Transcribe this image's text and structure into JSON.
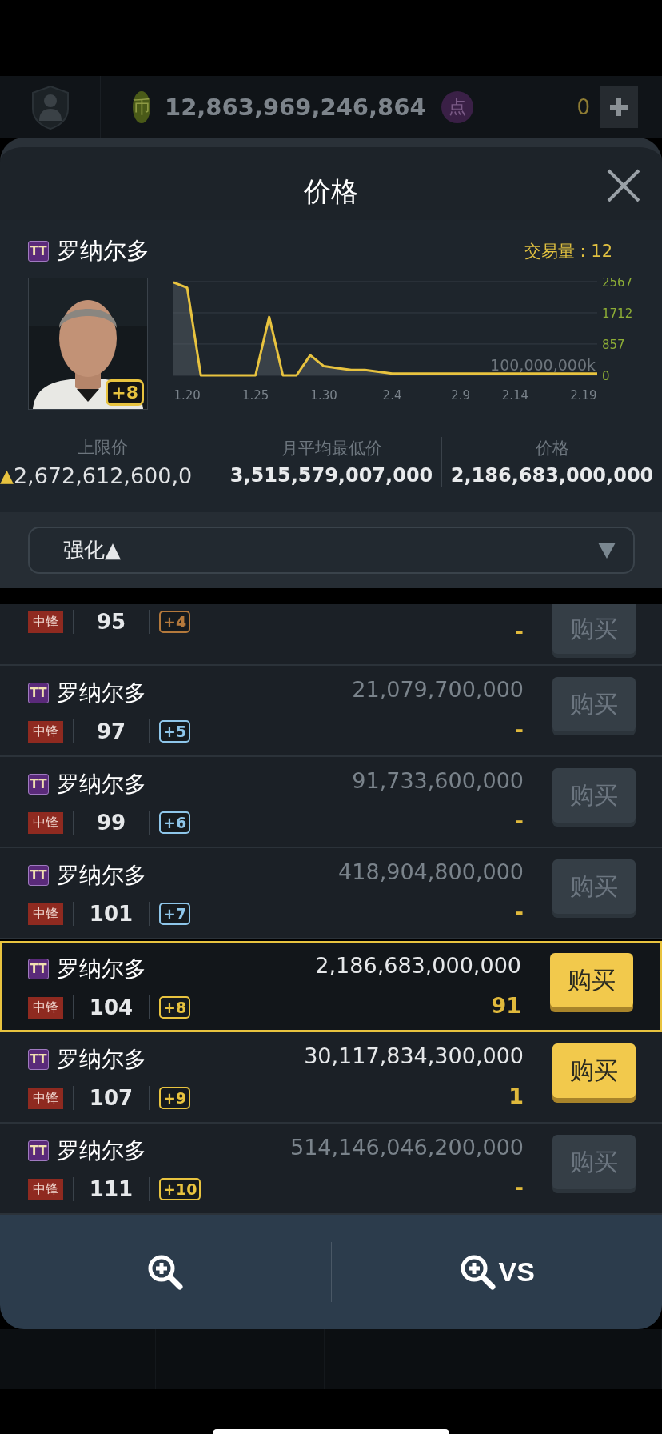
{
  "top_bar": {
    "coins": {
      "icon_text": "币",
      "amount": "12,863,969,246,864"
    },
    "points": {
      "icon_text": "点",
      "amount": "0"
    }
  },
  "modal": {
    "title": "价格"
  },
  "player": {
    "season": "TT",
    "name": "罗纳尔多",
    "grade": "+8",
    "color": "#e8c33f",
    "volume": "交易量 : 12",
    "chart_data": {
      "type": "area",
      "categories": [
        null,
        "1.20",
        null,
        null,
        null,
        null,
        "1.25",
        null,
        null,
        null,
        null,
        "1.30",
        null,
        null,
        null,
        null,
        "2.4",
        null,
        null,
        null,
        null,
        "2.9",
        null,
        null,
        null,
        "2.14",
        null,
        null,
        null,
        null,
        "2.19",
        null
      ],
      "values": [
        2550,
        2400,
        0,
        0,
        0,
        0,
        0,
        1600,
        0,
        0,
        550,
        250,
        200,
        150,
        150,
        100,
        50,
        50,
        50,
        50,
        50,
        50,
        50,
        50,
        50,
        50,
        50,
        50,
        50,
        50,
        50,
        50
      ],
      "ylim": [
        0,
        2567
      ],
      "yticks": [
        0,
        857,
        1712,
        2567
      ],
      "ylabel": "100,000,000k"
    }
  },
  "stats": [
    {
      "label": "上限价",
      "trend": "▲",
      "value": "2,672,612,600,0"
    },
    {
      "label": "月平均最低价",
      "value": "3,515,579,007,000"
    },
    {
      "label": "价格",
      "value": "2,186,683,000,000"
    }
  ],
  "sort_dropdown": {
    "value": "强化▲"
  },
  "rows": [
    {
      "kind": "partial",
      "position": "中锋",
      "rating": "95",
      "grade": "+4",
      "color": "#b4793c",
      "count": "-",
      "buy": {
        "label": "购买",
        "disabled": true
      },
      "selected": false
    },
    {
      "kind": "full",
      "season": "TT",
      "name": "罗纳尔多",
      "position": "中锋",
      "rating": "97",
      "grade": "+5",
      "color": "#8ec6ea",
      "price": "21,079,700,000",
      "count": "-",
      "buy": {
        "label": "购买",
        "disabled": true
      },
      "selected": false
    },
    {
      "kind": "full",
      "season": "TT",
      "name": "罗纳尔多",
      "position": "中锋",
      "rating": "99",
      "grade": "+6",
      "color": "#8ec6ea",
      "price": "91,733,600,000",
      "count": "-",
      "buy": {
        "label": "购买",
        "disabled": true
      },
      "selected": false
    },
    {
      "kind": "full",
      "season": "TT",
      "name": "罗纳尔多",
      "position": "中锋",
      "rating": "101",
      "grade": "+7",
      "color": "#8ec6ea",
      "price": "418,904,800,000",
      "count": "-",
      "buy": {
        "label": "购买",
        "disabled": true
      },
      "selected": false
    },
    {
      "kind": "full",
      "season": "TT",
      "name": "罗纳尔多",
      "position": "中锋",
      "rating": "104",
      "grade": "+8",
      "color": "#e8c33f",
      "price": "2,186,683,000,000",
      "count": "91",
      "buy": {
        "label": "购买",
        "disabled": false
      },
      "selected": true
    },
    {
      "kind": "full",
      "season": "TT",
      "name": "罗纳尔多",
      "position": "中锋",
      "rating": "107",
      "grade": "+9",
      "color": "#e8c33f",
      "price": "30,117,834,300,000",
      "count": "1",
      "buy": {
        "label": "购买",
        "disabled": false
      },
      "selected": false
    },
    {
      "kind": "full",
      "season": "TT",
      "name": "罗纳尔多",
      "position": "中锋",
      "rating": "111",
      "grade": "+10",
      "color": "#e8c33f",
      "price": "514,146,046,200,000",
      "count": "-",
      "buy": {
        "label": "购买",
        "disabled": true
      },
      "selected": false
    }
  ],
  "bottom_bar": {
    "compare_label": "VS"
  }
}
